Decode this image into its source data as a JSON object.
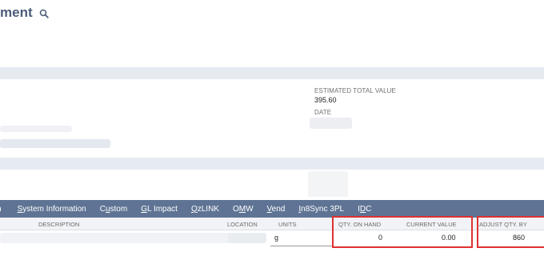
{
  "header": {
    "title": "ment"
  },
  "summary": {
    "estimated_total_value_label": "ESTIMATED TOTAL VALUE",
    "estimated_total_value": "395.60",
    "date_label": "DATE"
  },
  "subtabs": [
    {
      "pre": "",
      "u": "",
      "post": "n"
    },
    {
      "pre": "",
      "u": "S",
      "post": "ystem Information"
    },
    {
      "pre": "C",
      "u": "u",
      "post": "stom"
    },
    {
      "pre": "",
      "u": "G",
      "post": "L Impact"
    },
    {
      "pre": "",
      "u": "Q",
      "post": "zLINK"
    },
    {
      "pre": "O",
      "u": "M",
      "post": "W"
    },
    {
      "pre": "",
      "u": "V",
      "post": "end"
    },
    {
      "pre": "",
      "u": "I",
      "post": "n8Sync 3PL"
    },
    {
      "pre": "I",
      "u": "D",
      "post": "C"
    }
  ],
  "table": {
    "headers": {
      "description": "DESCRIPTION",
      "location": "LOCATION",
      "units": "UNITS",
      "qty_on_hand": "QTY. ON HAND",
      "current_value": "CURRENT VALUE",
      "adjust_qty_by": "ADJUST QTY. BY"
    },
    "row": {
      "units": "g",
      "qty_on_hand": "0",
      "current_value": "0.00",
      "adjust_qty_by": "860"
    }
  },
  "colors": {
    "title": "#4b5d78",
    "subtab_bar": "#5f7494",
    "band": "#e6eaf1",
    "highlight": "#e03131"
  }
}
